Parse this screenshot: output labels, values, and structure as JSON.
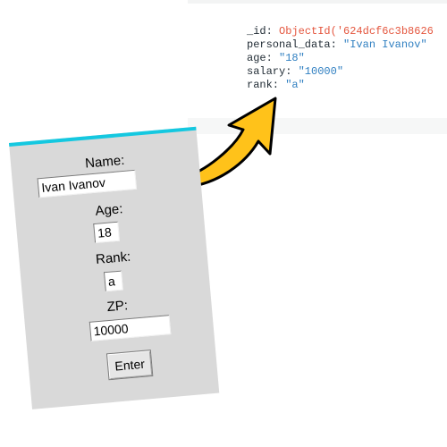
{
  "document": {
    "lines": [
      {
        "key": "_id: ",
        "value": "ObjectId('624dcf6c3b8626"
      },
      {
        "key": "personal_data: ",
        "value": "\"Ivan Ivanov\""
      },
      {
        "key": "age: ",
        "value": "\"18\""
      },
      {
        "key": "salary: ",
        "value": "\"10000\""
      },
      {
        "key": "rank: ",
        "value": "\"a\""
      }
    ]
  },
  "form": {
    "name_label": "Name:",
    "name_value": "Ivan Ivanov",
    "age_label": "Age:",
    "age_value": "18",
    "rank_label": "Rank:",
    "rank_value": "a",
    "zp_label": "ZP:",
    "zp_value": "10000",
    "enter_label": "Enter"
  },
  "colors": {
    "window_accent": "#14c8e0",
    "arrow_fill": "#ffc21a",
    "oid_color": "#e4563e",
    "string_color": "#2f7fc1"
  },
  "icons": {
    "arrow": "curved-arrow-icon"
  }
}
